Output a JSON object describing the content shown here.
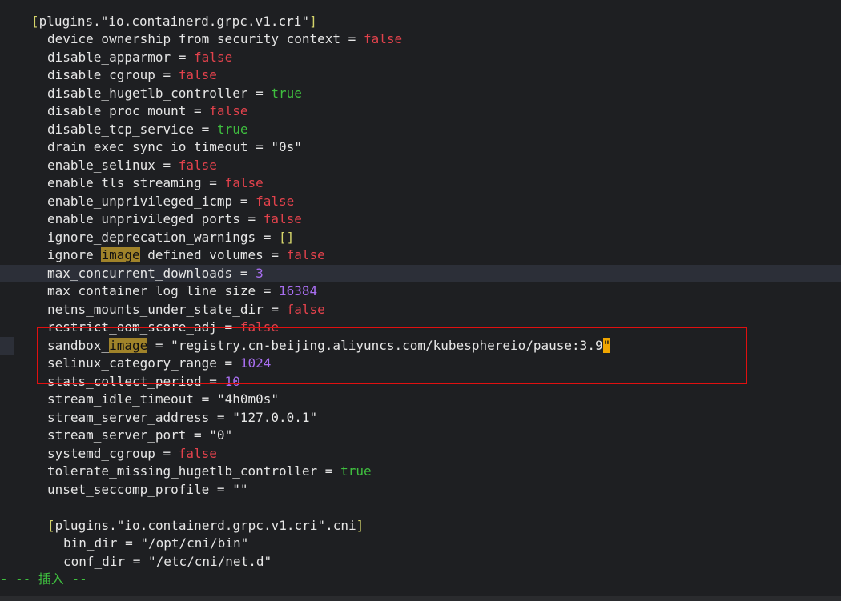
{
  "editor": {
    "mode": "-- 插入 --",
    "lines": [
      {
        "indent": "  ",
        "type": "section",
        "text": "[plugins.\"io.containerd.grpc.v1.cri\"]"
      },
      {
        "indent": "    ",
        "key": "device_ownership_from_security_context",
        "value": "false",
        "vtype": "false"
      },
      {
        "indent": "    ",
        "key": "disable_apparmor",
        "value": "false",
        "vtype": "false"
      },
      {
        "indent": "    ",
        "key": "disable_cgroup",
        "value": "false",
        "vtype": "false"
      },
      {
        "indent": "    ",
        "key": "disable_hugetlb_controller",
        "value": "true",
        "vtype": "true"
      },
      {
        "indent": "    ",
        "key": "disable_proc_mount",
        "value": "false",
        "vtype": "false"
      },
      {
        "indent": "    ",
        "key": "disable_tcp_service",
        "value": "true",
        "vtype": "true"
      },
      {
        "indent": "    ",
        "key": "drain_exec_sync_io_timeout",
        "value": "\"0s\"",
        "vtype": "str"
      },
      {
        "indent": "    ",
        "key": "enable_selinux",
        "value": "false",
        "vtype": "false"
      },
      {
        "indent": "    ",
        "key": "enable_tls_streaming",
        "value": "false",
        "vtype": "false"
      },
      {
        "indent": "    ",
        "key": "enable_unprivileged_icmp",
        "value": "false",
        "vtype": "false"
      },
      {
        "indent": "    ",
        "key": "enable_unprivileged_ports",
        "value": "false",
        "vtype": "false"
      },
      {
        "indent": "    ",
        "key": "ignore_deprecation_warnings",
        "value": "[]",
        "vtype": "arr"
      },
      {
        "indent": "    ",
        "key_pre": "ignore_",
        "key_hl": "image",
        "key_post": "_defined_volumes",
        "value": "false",
        "vtype": "false"
      },
      {
        "indent": "    ",
        "key": "max_concurrent_downloads",
        "value": "3",
        "vtype": "num",
        "cursorline": true
      },
      {
        "indent": "    ",
        "key": "max_container_log_line_size",
        "value": "16384",
        "vtype": "num"
      },
      {
        "indent": "    ",
        "key": "netns_mounts_under_state_dir",
        "value": "false",
        "vtype": "false"
      },
      {
        "indent": "    ",
        "key": "restrict_oom_score_adj",
        "value": "false",
        "vtype": "false"
      },
      {
        "indent": "    ",
        "key_pre": "sandbox_",
        "key_hl": "image",
        "key_post": "",
        "value_pre": "\"registry.cn-beijing.aliyuncs.com/kubesphereio/pause:3.9",
        "value_cursor": "\"",
        "vtype": "cursor",
        "gutter": true
      },
      {
        "indent": "    ",
        "key": "selinux_category_range",
        "value": "1024",
        "vtype": "num"
      },
      {
        "indent": "    ",
        "key": "stats_collect_period",
        "value": "10",
        "vtype": "num"
      },
      {
        "indent": "    ",
        "key": "stream_idle_timeout",
        "value": "\"4h0m0s\"",
        "vtype": "str"
      },
      {
        "indent": "    ",
        "key": "stream_server_address",
        "value_q1": "\"",
        "value_ul": "127.0.0.1",
        "value_q2": "\"",
        "vtype": "underline"
      },
      {
        "indent": "    ",
        "key": "stream_server_port",
        "value": "\"0\"",
        "vtype": "str"
      },
      {
        "indent": "    ",
        "key": "systemd_cgroup",
        "value": "false",
        "vtype": "false"
      },
      {
        "indent": "    ",
        "key": "tolerate_missing_hugetlb_controller",
        "value": "true",
        "vtype": "true"
      },
      {
        "indent": "    ",
        "key": "unset_seccomp_profile",
        "value": "\"\"",
        "vtype": "str"
      },
      {
        "indent": "",
        "type": "blank"
      },
      {
        "indent": "    ",
        "type": "section",
        "text": "[plugins.\"io.containerd.grpc.v1.cri\".cni]"
      },
      {
        "indent": "      ",
        "key": "bin_dir",
        "value": "\"/opt/cni/bin\"",
        "vtype": "str"
      },
      {
        "indent": "      ",
        "key": "conf_dir",
        "value": "\"/etc/cni/net.d\"",
        "vtype": "str"
      }
    ]
  },
  "colors": {
    "background": "#1e1f22",
    "false": "#e2424c",
    "true": "#3fbf3f",
    "number": "#a86ef0",
    "search_highlight": "#a0832a",
    "cursor": "#f0a500",
    "annotation_box": "#e01010"
  }
}
